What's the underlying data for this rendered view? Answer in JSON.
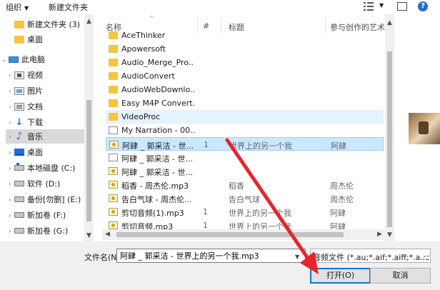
{
  "toolbar": {
    "organize_label": "组织",
    "new_folder_label": "新建文件夹"
  },
  "nav": {
    "items": [
      {
        "label": "新建文件夹 (3)",
        "icon": "folder-icon"
      },
      {
        "label": "桌面",
        "icon": "folder-icon"
      },
      {
        "label": "此电脑",
        "icon": "computer-icon"
      },
      {
        "label": "视频",
        "icon": "video-icon"
      },
      {
        "label": "图片",
        "icon": "image-icon"
      },
      {
        "label": "文档",
        "icon": "document-icon"
      },
      {
        "label": "下载",
        "icon": "download-icon"
      },
      {
        "label": "音乐",
        "icon": "music-icon"
      },
      {
        "label": "桌面",
        "icon": "desktop-icon"
      },
      {
        "label": "本地磁盘 (C:)",
        "icon": "drive-icon"
      },
      {
        "label": "软件 (D:)",
        "icon": "drive-icon"
      },
      {
        "label": "备份[勿删] (E:)",
        "icon": "drive-icon"
      },
      {
        "label": "新加卷 (F:)",
        "icon": "drive-icon"
      },
      {
        "label": "新加卷 (G:)",
        "icon": "drive-icon"
      }
    ]
  },
  "list": {
    "columns": {
      "name": "名称",
      "number": "#",
      "title": "标题",
      "artist": "参与创作的艺术"
    },
    "rows": [
      {
        "name": "AceThinker",
        "num": "",
        "title": "",
        "artist": "",
        "type": "folder"
      },
      {
        "name": "Apowersoft",
        "num": "",
        "title": "",
        "artist": "",
        "type": "folder"
      },
      {
        "name": "Audio_Merge_Pro...",
        "num": "",
        "title": "",
        "artist": "",
        "type": "folder"
      },
      {
        "name": "AudioConvert",
        "num": "",
        "title": "",
        "artist": "",
        "type": "folder"
      },
      {
        "name": "AudioWebDownlo...",
        "num": "",
        "title": "",
        "artist": "",
        "type": "folder"
      },
      {
        "name": "Easy M4P Convert...",
        "num": "",
        "title": "",
        "artist": "",
        "type": "folder"
      },
      {
        "name": "VideoProc",
        "num": "",
        "title": "",
        "artist": "",
        "type": "folder"
      },
      {
        "name": "My Narration - 00...",
        "num": "",
        "title": "",
        "artist": "",
        "type": "file"
      },
      {
        "name": "阿肆 _ 郭采洁 - 世...",
        "num": "1",
        "title": "世界上的另一个我",
        "artist": "阿肆",
        "type": "audio"
      },
      {
        "name": "阿肆 _ 郭采洁 - 世...",
        "num": "",
        "title": "",
        "artist": "",
        "type": "file"
      },
      {
        "name": "阿肆 _ 郭采洁 - 世...",
        "num": "",
        "title": "",
        "artist": "",
        "type": "audio"
      },
      {
        "name": "稻香 - 周杰伦.mp3",
        "num": "",
        "title": "稻香",
        "artist": "周杰伦",
        "type": "audio"
      },
      {
        "name": "告白气球 - 周杰伦...",
        "num": "",
        "title": "告白气球",
        "artist": "周杰伦",
        "type": "audio"
      },
      {
        "name": "剪切音频(1).mp3",
        "num": "1",
        "title": "世界上的另一个我",
        "artist": "阿肆",
        "type": "audio"
      },
      {
        "name": "剪切音频.mp3",
        "num": "1",
        "title": "世界上的另一个我",
        "artist": "阿肆",
        "type": "audio"
      }
    ]
  },
  "footer": {
    "file_name_label": "文件名(N):",
    "file_name_value": "阿肆 _ 郭采洁 - 世界上的另一个我.mp3",
    "file_type_value": "音频文件 (*.au;*.aif;*.aiff;*.aifc",
    "open_label": "打开(O)",
    "cancel_label": "取消"
  },
  "colors": {
    "accent": "#0078d7",
    "selection": "#cce8ff",
    "hover": "#e5f3ff",
    "arrow": "#e8242b"
  }
}
